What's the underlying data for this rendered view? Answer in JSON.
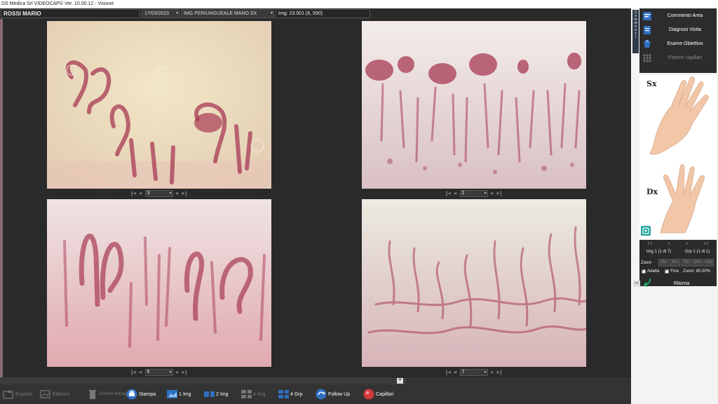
{
  "window": {
    "title": "DS Medica Srl VIDEOCAP© Ver. 10.00.12 - Visione"
  },
  "header": {
    "patient": "ROSSI MARIO",
    "date": "17/03/2023",
    "image_type": "IMG PERIUNGUEALE MANO SX",
    "image_info": "Img: 23.001 (6, 590)"
  },
  "panels": [
    {
      "nav_first": "|<",
      "nav_prev": "<",
      "index": "3",
      "nav_next": ">",
      "nav_last": ">|"
    },
    {
      "nav_first": "|<",
      "nav_prev": "<",
      "index": "2",
      "nav_next": ">",
      "nav_last": ">|"
    },
    {
      "nav_first": "|<",
      "nav_prev": "<",
      "index": "5",
      "nav_next": ">",
      "nav_last": ">|"
    },
    {
      "nav_first": "|<",
      "nav_prev": "<",
      "index": "7",
      "nav_next": ">",
      "nav_last": ">|"
    }
  ],
  "side": {
    "vertical_tab": "Commenti",
    "menu": [
      {
        "label": "Commento Area",
        "icon": "comment-area-icon",
        "disabled": false
      },
      {
        "label": "Diagnosi Visita",
        "icon": "diagnosis-icon",
        "disabled": false
      },
      {
        "label": "Esame Obiettivo",
        "icon": "exam-icon",
        "disabled": false
      },
      {
        "label": "Pattern capillari",
        "icon": "pattern-grid-icon",
        "disabled": true
      }
    ],
    "hand_sx": "Sx",
    "hand_dx": "Dx",
    "nav": {
      "first": "|<",
      "prev": "<",
      "next": ">",
      "last": ">|"
    },
    "img_counter": "Img 1 (1 di 7)",
    "grp_counter": "Grp 1 (1 di 1)",
    "zoom_label": "Zoom",
    "zoom_levels": [
      "30x",
      "50x",
      "70x",
      "100x",
      "160x"
    ],
    "adatta": "Adatta",
    "fine": "Fine",
    "zoom_value": "Zoom: 80.00%",
    "back": "Ritorna",
    "collapse": ">>"
  },
  "toolbar": {
    "collapse_indicator": "▾",
    "buttons": [
      {
        "label": "Esporta",
        "disabled": true
      },
      {
        "label": "Elabora",
        "disabled": true
      },
      {
        "label": "Elimina Immagine",
        "disabled": true
      },
      {
        "label": "Stampa",
        "disabled": false
      },
      {
        "label": "1 Img",
        "disabled": false
      },
      {
        "label": "2 Img",
        "disabled": false
      },
      {
        "label": "4 Img",
        "disabled": true
      },
      {
        "label": "4 Grp",
        "disabled": false
      },
      {
        "label": "Follow Up",
        "disabled": false
      },
      {
        "label": "Capillari",
        "disabled": false
      }
    ]
  },
  "colors": {
    "accent_blue": "#2f6fc2",
    "teal": "#23a6a0",
    "capillary": "#a83a55",
    "background": "#2a2a2a"
  }
}
